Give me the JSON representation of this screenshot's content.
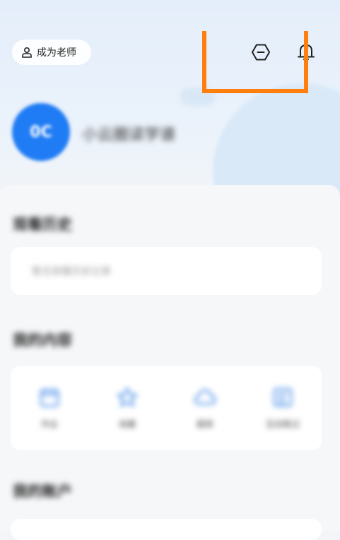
{
  "header": {
    "teacher_label": "成为老师",
    "person_icon": "person-outline-icon",
    "hexagon_icon": "hexagon-minus-icon",
    "bell_icon": "bell-icon"
  },
  "profile": {
    "avatar_text": "0C",
    "username": "小云圈读学谱"
  },
  "sections": {
    "history_title": "观看历史",
    "history_placeholder": "暂无观看历史记录",
    "content_title": "我的内容",
    "account_title": "我的账户"
  },
  "content_items": [
    {
      "label": "作业",
      "icon": "calendar-icon"
    },
    {
      "label": "收藏",
      "icon": "star-icon"
    },
    {
      "label": "题库",
      "icon": "cloud-icon"
    },
    {
      "label": "互动笔记",
      "icon": "note-icon"
    }
  ],
  "colors": {
    "accent_blue": "#1f7cf4",
    "annotation_orange": "#ff7f0e",
    "icon_blue": "#4a8ee8"
  }
}
